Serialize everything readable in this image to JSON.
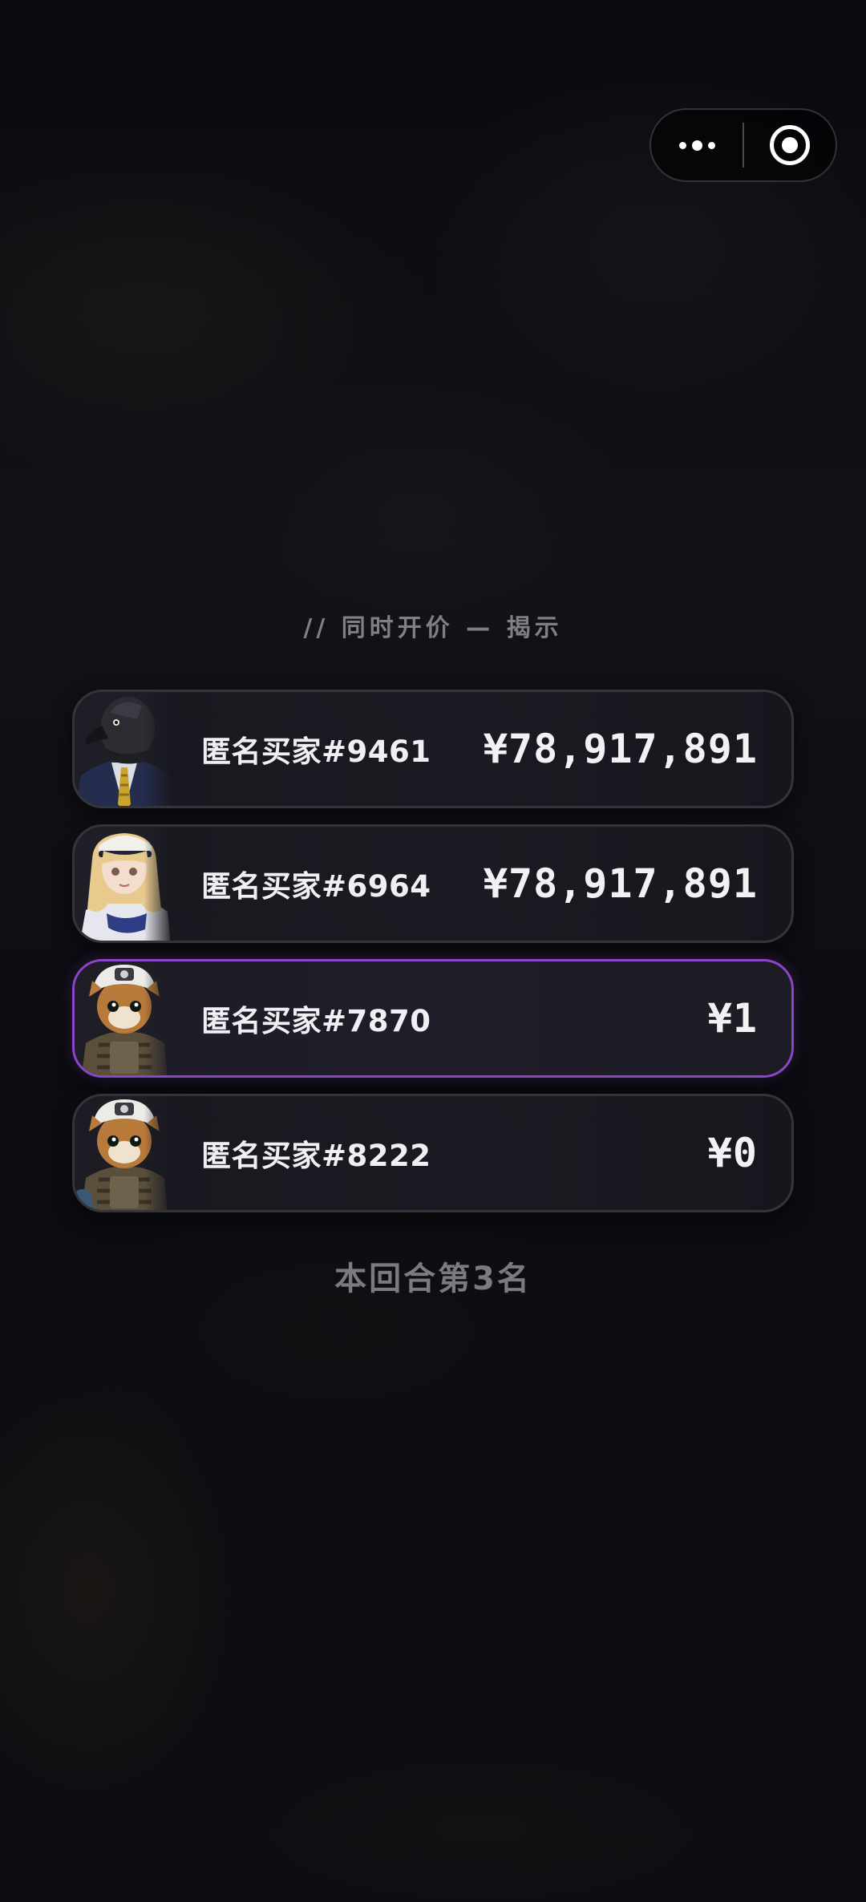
{
  "capsule": {
    "more_icon": "more-dots-icon",
    "close_icon": "target-circle-icon"
  },
  "reveal": {
    "title": "// 同时开价 — 揭示"
  },
  "bids": [
    {
      "buyer": "匿名买家#9461",
      "amount": "¥78,917,891",
      "avatar": "penguin-in-suit-avatar",
      "mine": false
    },
    {
      "buyer": "匿名买家#6964",
      "amount": "¥78,917,891",
      "avatar": "blonde-girl-avatar",
      "mine": false
    },
    {
      "buyer": "匿名买家#7870",
      "amount": "¥1",
      "avatar": "armored-cat-avatar",
      "mine": true
    },
    {
      "buyer": "匿名买家#8222",
      "amount": "¥0",
      "avatar": "armored-cat-avatar",
      "mine": false
    }
  ],
  "result": {
    "rank_text": "本回合第3名"
  },
  "colors": {
    "background": "#0b0b10",
    "row_border": "#34343b",
    "highlight_border": "#8a46c9",
    "muted_text": "#7f7f87"
  }
}
